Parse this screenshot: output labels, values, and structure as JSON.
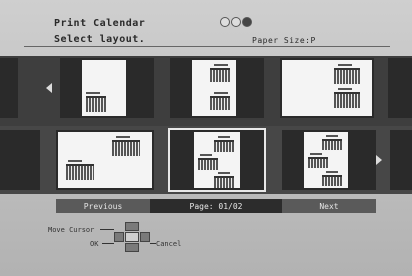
{
  "header": {
    "title": "Print Calendar",
    "subtitle": "Select layout.",
    "paper_size": "Paper Size:P"
  },
  "mode_indicator": {
    "icons": [
      "dial-circle-icon",
      "dial-circle-icon",
      "dial-circle-icon"
    ]
  },
  "layouts": {
    "count_visible": 6,
    "selected_index": 4,
    "items": [
      "layout-1",
      "layout-2",
      "layout-3",
      "layout-4",
      "layout-5",
      "layout-6"
    ]
  },
  "navigation": {
    "previous_label": "Previous",
    "page_label": "Page: 01/02",
    "next_label": "Next"
  },
  "help": {
    "move_cursor": "Move Cursor",
    "ok": "OK",
    "cancel": "Cancel"
  },
  "colors": {
    "background": "#bdbdbd",
    "band": "#3e3e3e",
    "tile": "#2a2a2a",
    "paper": "#f4f4f4",
    "selected_border": "#e8e8e8"
  }
}
